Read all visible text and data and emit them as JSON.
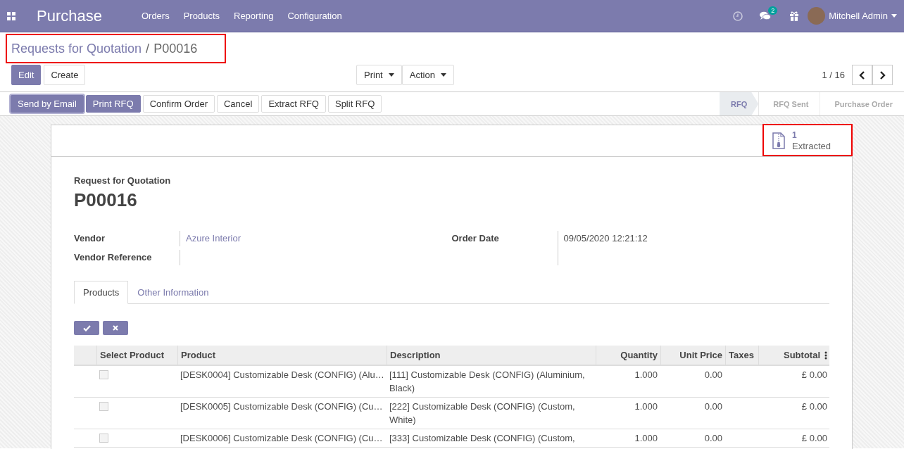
{
  "navbar": {
    "app_name": "Purchase",
    "menu": [
      "Orders",
      "Products",
      "Reporting",
      "Configuration"
    ],
    "messages_count": "2",
    "user": "Mitchell Admin"
  },
  "breadcrumb": {
    "parent": "Requests for Quotation",
    "separator": "/",
    "current": "P00016"
  },
  "buttons": [
    {
      "label": "Edit",
      "kind": "primary"
    },
    {
      "label": "Create",
      "kind": "secondary"
    }
  ],
  "dropdowns": [
    "Print",
    "Action"
  ],
  "pager": "1 / 16",
  "header_buttons": [
    {
      "label": "Send by Email",
      "kind": "primary"
    },
    {
      "label": "Print RFQ",
      "kind": "primary"
    },
    {
      "label": "Confirm Order",
      "kind": "secondary"
    },
    {
      "label": "Cancel",
      "kind": "secondary"
    },
    {
      "label": "Extract RFQ",
      "kind": "secondary"
    },
    {
      "label": "Split RFQ",
      "kind": "secondary"
    }
  ],
  "status_steps": [
    {
      "label": "RFQ",
      "selected": true
    },
    {
      "label": "RFQ Sent",
      "selected": false
    },
    {
      "label": "Purchase Order",
      "selected": false
    }
  ],
  "smart_button": {
    "count": "1",
    "label": "Extracted"
  },
  "form": {
    "subtitle": "Request for Quotation",
    "name": "P00016",
    "fields_left": [
      {
        "label": "Vendor",
        "value": "Azure Interior"
      },
      {
        "label": "Vendor Reference"
      }
    ],
    "fields_right": [
      {
        "label": "Order Date",
        "value": "09/05/2020 12:21:12"
      }
    ]
  },
  "tabs": [
    {
      "label": "Products",
      "selected": true
    },
    {
      "label": "Other Information",
      "selected": false
    }
  ],
  "table": {
    "columns": [
      "Select Product",
      "Product",
      "Description",
      "Quantity",
      "Unit Price",
      "Taxes",
      "Subtotal"
    ],
    "rows": [
      {
        "checked": false,
        "product": "[DESK0004] Customizable Desk (CONFIG) (Alu…",
        "description": "[111] Customizable Desk (CONFIG) (Aluminium, Black)",
        "quantity": "1.000",
        "unit_price": "0.00",
        "subtotal": "£ 0.00"
      },
      {
        "checked": false,
        "product": "[DESK0005] Customizable Desk (CONFIG) (Cu…",
        "description": "[222] Customizable Desk (CONFIG) (Custom, White)",
        "quantity": "1.000",
        "unit_price": "0.00",
        "subtotal": "£ 0.00"
      },
      {
        "checked": false,
        "product": "[DESK0006] Customizable Desk (CONFIG) (Cu…",
        "description": "[333] Customizable Desk (CONFIG) (Custom,",
        "quantity": "1.000",
        "unit_price": "0.00",
        "subtotal": "£ 0.00"
      }
    ]
  }
}
